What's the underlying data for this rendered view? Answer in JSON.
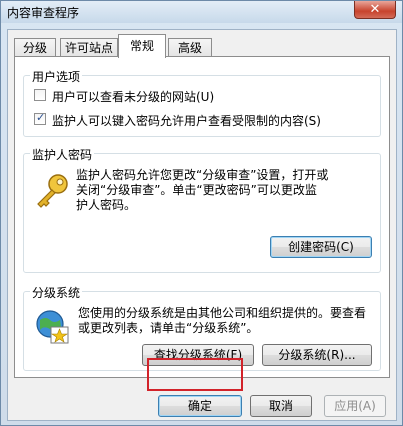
{
  "window": {
    "title": "内容审查程序",
    "close_label": "✕"
  },
  "tabs": [
    {
      "label": "分级"
    },
    {
      "label": "许可站点"
    },
    {
      "label": "常规"
    },
    {
      "label": "高级"
    }
  ],
  "user_options": {
    "title": "用户选项",
    "options": [
      {
        "label": "用户可以查看未分级的网站(U)",
        "checked": false
      },
      {
        "label": "监护人可以键入密码允许用户查看受限制的内容(S)",
        "checked": true
      }
    ]
  },
  "supervisor_password": {
    "title": "监护人密码",
    "description_lines": [
      "监护人密码允许您更改“分级审查”设置，打开或",
      "关闭“分级审查”。单击“更改密码”可以更改监",
      "护人密码。"
    ],
    "icon": "key-icon",
    "create_button": "创建密码(C)"
  },
  "rating_systems": {
    "title": "分级系统",
    "description_lines": [
      "您使用的分级系统是由其他公司和组织提供的。要查看",
      "或更改列表，请单击“分级系统”。"
    ],
    "icon": "rating-globe-icon",
    "find_button": "查找分级系统(F)",
    "systems_button": "分级系统(R)..."
  },
  "footer": {
    "ok": "确定",
    "cancel": "取消",
    "apply": "应用(A)"
  },
  "colors": {
    "highlight": "#d2232a",
    "accent": "#3c7fb1"
  }
}
